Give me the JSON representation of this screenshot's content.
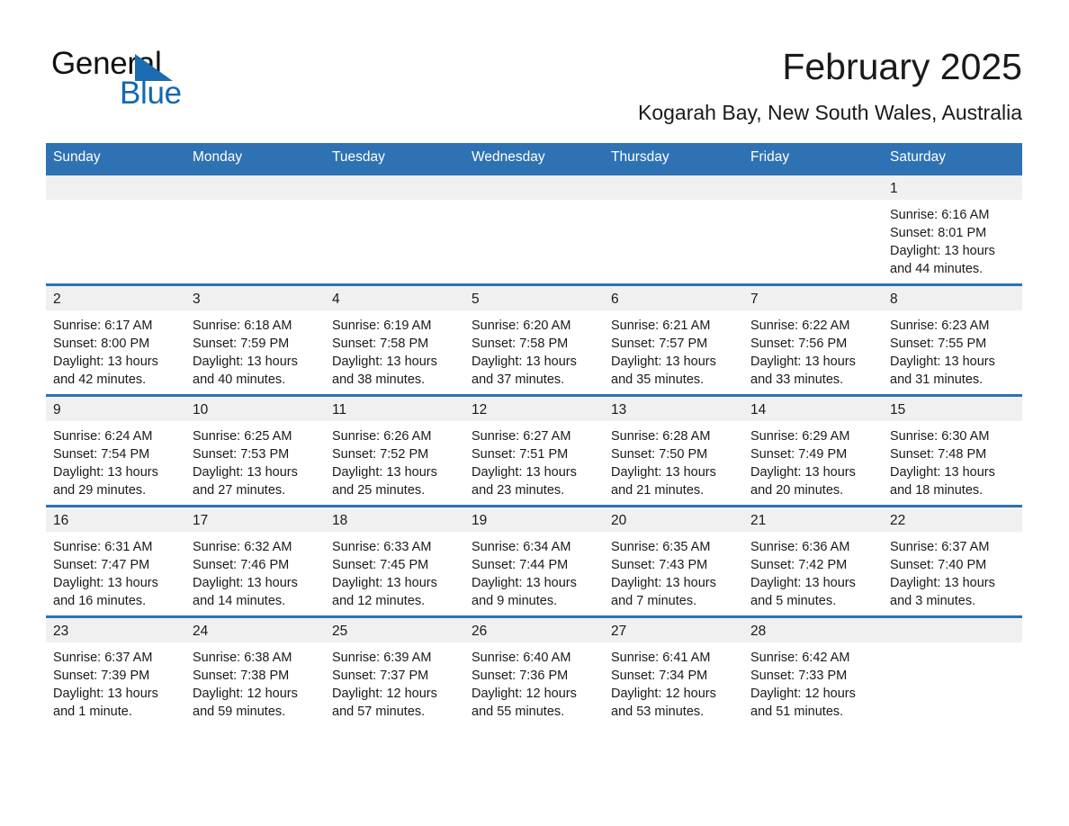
{
  "brand": {
    "name_part1": "General",
    "name_part2": "Blue",
    "logo_icon": "triangle-flag-icon",
    "accent_color": "#1268b3"
  },
  "header": {
    "title": "February 2025",
    "subtitle": "Kogarah Bay, New South Wales, Australia"
  },
  "colors": {
    "header_blue": "#2e72b4",
    "daynum_band": "#f0f0f0",
    "text": "#1a1a1a"
  },
  "calendar": {
    "weekday_headers": [
      "Sunday",
      "Monday",
      "Tuesday",
      "Wednesday",
      "Thursday",
      "Friday",
      "Saturday"
    ],
    "weeks": [
      [
        {
          "empty": true
        },
        {
          "empty": true
        },
        {
          "empty": true
        },
        {
          "empty": true
        },
        {
          "empty": true
        },
        {
          "empty": true
        },
        {
          "day": "1",
          "sunrise": "Sunrise: 6:16 AM",
          "sunset": "Sunset: 8:01 PM",
          "daylight": "Daylight: 13 hours and 44 minutes."
        }
      ],
      [
        {
          "day": "2",
          "sunrise": "Sunrise: 6:17 AM",
          "sunset": "Sunset: 8:00 PM",
          "daylight": "Daylight: 13 hours and 42 minutes."
        },
        {
          "day": "3",
          "sunrise": "Sunrise: 6:18 AM",
          "sunset": "Sunset: 7:59 PM",
          "daylight": "Daylight: 13 hours and 40 minutes."
        },
        {
          "day": "4",
          "sunrise": "Sunrise: 6:19 AM",
          "sunset": "Sunset: 7:58 PM",
          "daylight": "Daylight: 13 hours and 38 minutes."
        },
        {
          "day": "5",
          "sunrise": "Sunrise: 6:20 AM",
          "sunset": "Sunset: 7:58 PM",
          "daylight": "Daylight: 13 hours and 37 minutes."
        },
        {
          "day": "6",
          "sunrise": "Sunrise: 6:21 AM",
          "sunset": "Sunset: 7:57 PM",
          "daylight": "Daylight: 13 hours and 35 minutes."
        },
        {
          "day": "7",
          "sunrise": "Sunrise: 6:22 AM",
          "sunset": "Sunset: 7:56 PM",
          "daylight": "Daylight: 13 hours and 33 minutes."
        },
        {
          "day": "8",
          "sunrise": "Sunrise: 6:23 AM",
          "sunset": "Sunset: 7:55 PM",
          "daylight": "Daylight: 13 hours and 31 minutes."
        }
      ],
      [
        {
          "day": "9",
          "sunrise": "Sunrise: 6:24 AM",
          "sunset": "Sunset: 7:54 PM",
          "daylight": "Daylight: 13 hours and 29 minutes."
        },
        {
          "day": "10",
          "sunrise": "Sunrise: 6:25 AM",
          "sunset": "Sunset: 7:53 PM",
          "daylight": "Daylight: 13 hours and 27 minutes."
        },
        {
          "day": "11",
          "sunrise": "Sunrise: 6:26 AM",
          "sunset": "Sunset: 7:52 PM",
          "daylight": "Daylight: 13 hours and 25 minutes."
        },
        {
          "day": "12",
          "sunrise": "Sunrise: 6:27 AM",
          "sunset": "Sunset: 7:51 PM",
          "daylight": "Daylight: 13 hours and 23 minutes."
        },
        {
          "day": "13",
          "sunrise": "Sunrise: 6:28 AM",
          "sunset": "Sunset: 7:50 PM",
          "daylight": "Daylight: 13 hours and 21 minutes."
        },
        {
          "day": "14",
          "sunrise": "Sunrise: 6:29 AM",
          "sunset": "Sunset: 7:49 PM",
          "daylight": "Daylight: 13 hours and 20 minutes."
        },
        {
          "day": "15",
          "sunrise": "Sunrise: 6:30 AM",
          "sunset": "Sunset: 7:48 PM",
          "daylight": "Daylight: 13 hours and 18 minutes."
        }
      ],
      [
        {
          "day": "16",
          "sunrise": "Sunrise: 6:31 AM",
          "sunset": "Sunset: 7:47 PM",
          "daylight": "Daylight: 13 hours and 16 minutes."
        },
        {
          "day": "17",
          "sunrise": "Sunrise: 6:32 AM",
          "sunset": "Sunset: 7:46 PM",
          "daylight": "Daylight: 13 hours and 14 minutes."
        },
        {
          "day": "18",
          "sunrise": "Sunrise: 6:33 AM",
          "sunset": "Sunset: 7:45 PM",
          "daylight": "Daylight: 13 hours and 12 minutes."
        },
        {
          "day": "19",
          "sunrise": "Sunrise: 6:34 AM",
          "sunset": "Sunset: 7:44 PM",
          "daylight": "Daylight: 13 hours and 9 minutes."
        },
        {
          "day": "20",
          "sunrise": "Sunrise: 6:35 AM",
          "sunset": "Sunset: 7:43 PM",
          "daylight": "Daylight: 13 hours and 7 minutes."
        },
        {
          "day": "21",
          "sunrise": "Sunrise: 6:36 AM",
          "sunset": "Sunset: 7:42 PM",
          "daylight": "Daylight: 13 hours and 5 minutes."
        },
        {
          "day": "22",
          "sunrise": "Sunrise: 6:37 AM",
          "sunset": "Sunset: 7:40 PM",
          "daylight": "Daylight: 13 hours and 3 minutes."
        }
      ],
      [
        {
          "day": "23",
          "sunrise": "Sunrise: 6:37 AM",
          "sunset": "Sunset: 7:39 PM",
          "daylight": "Daylight: 13 hours and 1 minute."
        },
        {
          "day": "24",
          "sunrise": "Sunrise: 6:38 AM",
          "sunset": "Sunset: 7:38 PM",
          "daylight": "Daylight: 12 hours and 59 minutes."
        },
        {
          "day": "25",
          "sunrise": "Sunrise: 6:39 AM",
          "sunset": "Sunset: 7:37 PM",
          "daylight": "Daylight: 12 hours and 57 minutes."
        },
        {
          "day": "26",
          "sunrise": "Sunrise: 6:40 AM",
          "sunset": "Sunset: 7:36 PM",
          "daylight": "Daylight: 12 hours and 55 minutes."
        },
        {
          "day": "27",
          "sunrise": "Sunrise: 6:41 AM",
          "sunset": "Sunset: 7:34 PM",
          "daylight": "Daylight: 12 hours and 53 minutes."
        },
        {
          "day": "28",
          "sunrise": "Sunrise: 6:42 AM",
          "sunset": "Sunset: 7:33 PM",
          "daylight": "Daylight: 12 hours and 51 minutes."
        },
        {
          "empty": true
        }
      ]
    ]
  }
}
